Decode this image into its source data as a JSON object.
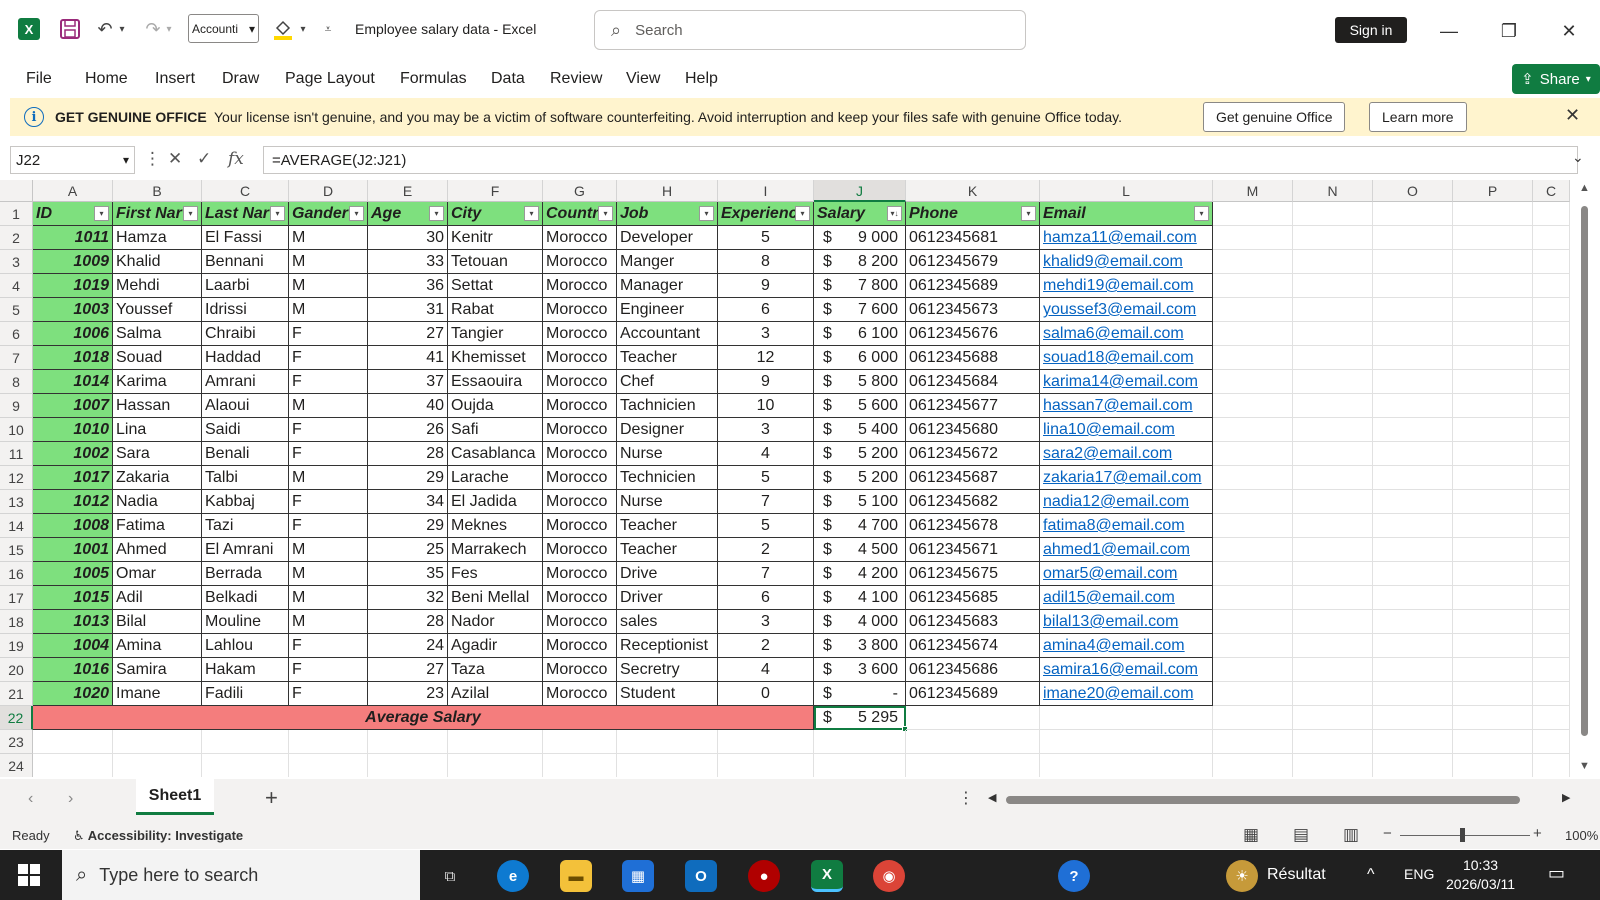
{
  "titlebar": {
    "font_box": "Accounti",
    "doc_title": "Employee salary data  -  Excel",
    "search_placeholder": "Search",
    "sign_in": "Sign in"
  },
  "menu": [
    "File",
    "Home",
    "Insert",
    "Draw",
    "Page Layout",
    "Formulas",
    "Data",
    "Review",
    "View",
    "Help"
  ],
  "share_label": "Share",
  "notice": {
    "title": "GET GENUINE OFFICE",
    "message": "Your license isn't genuine, and you may be a victim of software counterfeiting. Avoid interruption and keep your files safe with genuine Office today.",
    "button_primary": "Get genuine Office",
    "button_secondary": "Learn more"
  },
  "formula_bar": {
    "name_box": "J22",
    "formula": "=AVERAGE(J2:J21)"
  },
  "columns": [
    "A",
    "B",
    "C",
    "D",
    "E",
    "F",
    "G",
    "H",
    "I",
    "J",
    "K",
    "L",
    "M",
    "N",
    "O",
    "P",
    "C"
  ],
  "headers": [
    "ID",
    "First Nar",
    "Last Nar",
    "Gander",
    "Age",
    "City",
    "Countr",
    "Job",
    "Experienc",
    "Salary",
    "Phone",
    "Email"
  ],
  "rows": [
    [
      "1011",
      "Hamza",
      "El Fassi",
      "M",
      "30",
      "Kenitr",
      "Morocco",
      "Developer",
      "5",
      "9 000",
      "0612345681",
      "hamza11@email.com"
    ],
    [
      "1009",
      "Khalid",
      "Bennani",
      "M",
      "33",
      "Tetouan",
      "Morocco",
      "Manger",
      "8",
      "8 200",
      "0612345679",
      "khalid9@email.com"
    ],
    [
      "1019",
      "Mehdi",
      "Laarbi",
      "M",
      "36",
      "Settat",
      "Morocco",
      "Manager",
      "9",
      "7 800",
      "0612345689",
      "mehdi19@email.com"
    ],
    [
      "1003",
      "Youssef",
      "Idrissi",
      "M",
      "31",
      "Rabat",
      "Morocco",
      "Engineer",
      "6",
      "7 600",
      "0612345673",
      "youssef3@email.com"
    ],
    [
      "1006",
      "Salma",
      "Chraibi",
      "F",
      "27",
      "Tangier",
      "Morocco",
      "Accountant",
      "3",
      "6 100",
      "0612345676",
      "salma6@email.com"
    ],
    [
      "1018",
      "Souad",
      "Haddad",
      "F",
      "41",
      "Khemisset",
      "Morocco",
      "Teacher",
      "12",
      "6 000",
      "0612345688",
      "souad18@email.com"
    ],
    [
      "1014",
      "Karima",
      "Amrani",
      "F",
      "37",
      "Essaouira",
      "Morocco",
      "Chef",
      "9",
      "5 800",
      "0612345684",
      "karima14@email.com"
    ],
    [
      "1007",
      "Hassan",
      "Alaoui",
      "M",
      "40",
      "Oujda",
      "Morocco",
      "Tachnicien",
      "10",
      "5 600",
      "0612345677",
      "hassan7@email.com"
    ],
    [
      "1010",
      "Lina",
      "Saidi",
      "F",
      "26",
      "Safi",
      "Morocco",
      "Designer",
      "3",
      "5 400",
      "0612345680",
      "lina10@email.com"
    ],
    [
      "1002",
      "Sara",
      "Benali",
      "F",
      "28",
      "Casablanca",
      "Morocco",
      "Nurse",
      "4",
      "5 200",
      "0612345672",
      "sara2@email.com"
    ],
    [
      "1017",
      "Zakaria",
      "Talbi",
      "M",
      "29",
      "Larache",
      "Morocco",
      "Technicien",
      "5",
      "5 200",
      "0612345687",
      "zakaria17@email.com"
    ],
    [
      "1012",
      "Nadia",
      "Kabbaj",
      "F",
      "34",
      "El Jadida",
      "Morocco",
      "Nurse",
      "7",
      "5 100",
      "0612345682",
      "nadia12@email.com"
    ],
    [
      "1008",
      "Fatima",
      "Tazi",
      "F",
      "29",
      "Meknes",
      "Morocco",
      "Teacher",
      "5",
      "4 700",
      "0612345678",
      "fatima8@email.com"
    ],
    [
      "1001",
      "Ahmed",
      "El Amrani",
      "M",
      "25",
      "Marrakech",
      "Morocco",
      "Teacher",
      "2",
      "4 500",
      "0612345671",
      "ahmed1@email.com"
    ],
    [
      "1005",
      "Omar",
      "Berrada",
      "M",
      "35",
      "Fes",
      "Morocco",
      "Drive",
      "7",
      "4 200",
      "0612345675",
      "omar5@email.com"
    ],
    [
      "1015",
      "Adil",
      "Belkadi",
      "M",
      "32",
      "Beni Mellal",
      "Morocco",
      "Driver",
      "6",
      "4 100",
      "0612345685",
      "adil15@email.com"
    ],
    [
      "1013",
      "Bilal",
      "Mouline",
      "M",
      "28",
      "Nador",
      "Morocco",
      "sales",
      "3",
      "4 000",
      "0612345683",
      "bilal13@email.com"
    ],
    [
      "1004",
      "Amina",
      "Lahlou",
      "F",
      "24",
      "Agadir",
      "Morocco",
      "Receptionist",
      "2",
      "3 800",
      "0612345674",
      "amina4@email.com"
    ],
    [
      "1016",
      "Samira",
      "Hakam",
      "F",
      "27",
      "Taza",
      "Morocco",
      "Secretry",
      "4",
      "3 600",
      "0612345686",
      "samira16@email.com"
    ],
    [
      "1020",
      "Imane",
      "Fadili",
      "F",
      "23",
      "Azilal",
      "Morocco",
      "Student",
      "0",
      "-",
      "0612345689",
      "imane20@email.com"
    ]
  ],
  "currency_symbol": "$",
  "average": {
    "label": "Average Salary",
    "value": "5 295"
  },
  "row_numbers": [
    "1",
    "2",
    "3",
    "4",
    "5",
    "6",
    "7",
    "8",
    "9",
    "10",
    "11",
    "12",
    "13",
    "14",
    "15",
    "16",
    "17",
    "18",
    "19",
    "20",
    "21",
    "22",
    "23",
    "24"
  ],
  "sheet_tab": "Sheet1",
  "status": {
    "ready": "Ready",
    "accessibility": "Accessibility: Investigate",
    "zoom": "100%"
  },
  "taskbar": {
    "search_placeholder": "Type here to search",
    "weather": "Résultat",
    "language": "ENG",
    "time": "10:33",
    "date": "2026/03/11"
  },
  "colors": {
    "excel_green": "#107c41",
    "header_fill": "#7ee07e",
    "average_fill": "#f47d7d",
    "link": "#0563c1"
  }
}
